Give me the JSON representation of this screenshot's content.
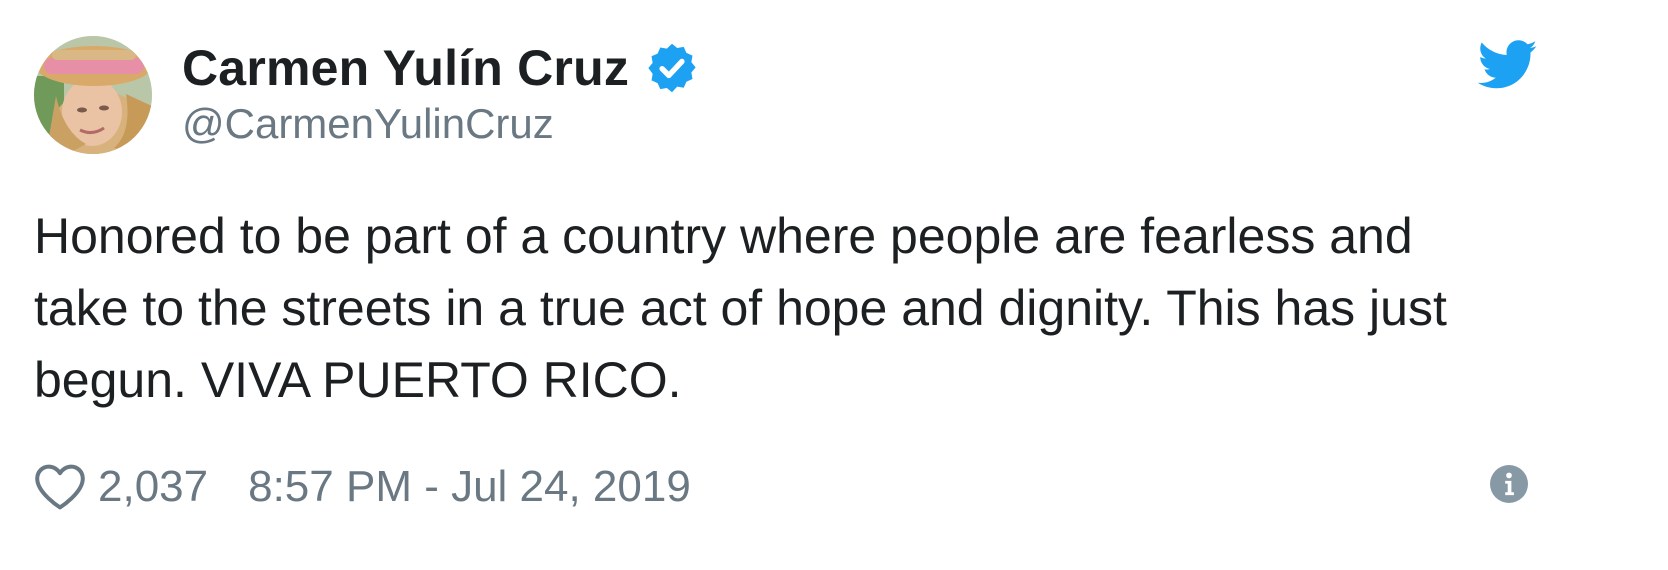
{
  "tweet": {
    "author": {
      "display_name": "Carmen Yulín Cruz",
      "handle": "@CarmenYulinCruz",
      "verified": true
    },
    "text": "Honored to be part of a country where people are fearless and\ntake to the streets in a true act of hope and dignity. This has just\nbegun. VIVA PUERTO RICO.",
    "likes": "2,037",
    "timestamp": "8:57 PM - Jul 24, 2019"
  },
  "icons": {
    "verified": "verified-badge-icon",
    "brand": "twitter-bird-icon",
    "like": "heart-icon",
    "info": "info-icon"
  },
  "colors": {
    "brand_blue": "#1da1f2",
    "text_primary": "#1c2022",
    "text_secondary": "#697882"
  }
}
